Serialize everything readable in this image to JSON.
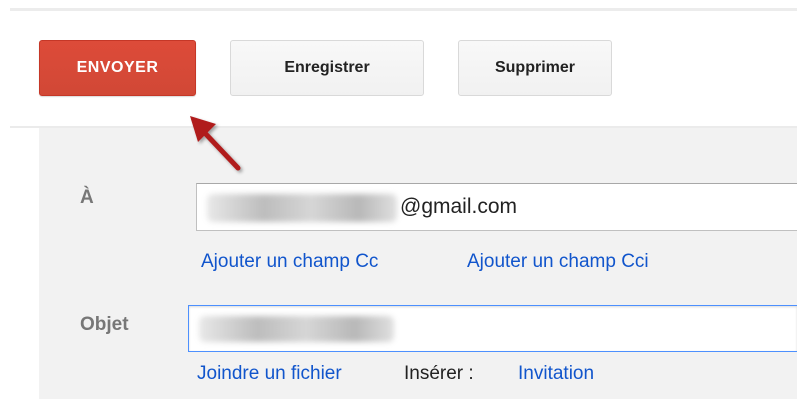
{
  "toolbar": {
    "send_label": "ENVOYER",
    "save_label": "Enregistrer",
    "delete_label": "Supprimer"
  },
  "compose": {
    "to_label": "À",
    "to_value_suffix": "@gmail.com",
    "add_cc_label": "Ajouter un champ Cc",
    "add_bcc_label": "Ajouter un champ Cci",
    "subject_label": "Objet",
    "attach_label": "Joindre un fichier",
    "insert_label": "Insérer :",
    "invite_label": "Invitation"
  },
  "colors": {
    "send_button": "#d14836",
    "link": "#1155cc",
    "arrow": "#b01e1e",
    "panel": "#f2f2f2"
  },
  "icons": [
    "annotation-arrow-icon"
  ]
}
